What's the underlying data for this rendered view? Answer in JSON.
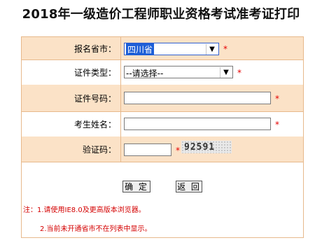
{
  "title": "2018年一级造价工程师职业资格考试准考证打印",
  "form": {
    "province_label": "报名省市：",
    "province_value": "四川省",
    "id_type_label": "证件类型：",
    "id_type_value": "--请选择--",
    "id_number_label": "证件号码：",
    "id_number_value": "",
    "name_label": "考生姓名：",
    "name_value": "",
    "captcha_label": "验证码：",
    "captcha_value": "",
    "captcha_image_text": "92591",
    "required_mark": "*"
  },
  "buttons": {
    "confirm": "确 定",
    "back": "返 回"
  },
  "notes": {
    "line1": "注：1.请使用IE8.0及更高版本浏览器。",
    "line2": "2.当前未开通省市不在列表中显示。"
  },
  "colors": {
    "border": "#e7b98c",
    "alt_row": "#fbe2c7",
    "required": "#e60000",
    "note": "#d40000"
  }
}
